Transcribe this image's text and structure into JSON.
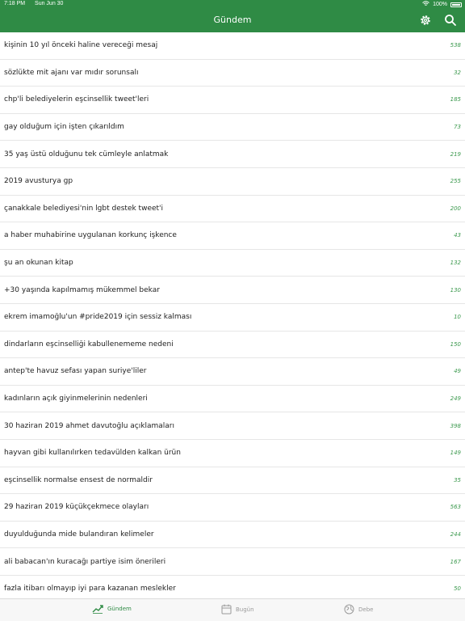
{
  "status_bar": {
    "time": "7:18 PM",
    "date": "Sun Jun 30",
    "battery": "100%"
  },
  "nav": {
    "title": "Gündem",
    "settings_icon": "gear-icon",
    "search_icon": "search-icon"
  },
  "topics": [
    {
      "title": "kişinin 10 yıl önceki haline vereceği mesaj",
      "count": "538"
    },
    {
      "title": "sözlükte mit ajanı var mıdır sorunsalı",
      "count": "32"
    },
    {
      "title": "chp'li belediyelerin eşcinsellik tweet'leri",
      "count": "185"
    },
    {
      "title": "gay olduğum için işten çıkarıldım",
      "count": "73"
    },
    {
      "title": "35 yaş üstü olduğunu tek cümleyle anlatmak",
      "count": "219"
    },
    {
      "title": "2019 avusturya gp",
      "count": "255"
    },
    {
      "title": "çanakkale belediyesi'nin lgbt destek tweet'i",
      "count": "200"
    },
    {
      "title": "a haber muhabirine uygulanan korkunç işkence",
      "count": "43"
    },
    {
      "title": "şu an okunan kitap",
      "count": "132"
    },
    {
      "title": "+30 yaşında kapılmamış mükemmel bekar",
      "count": "130"
    },
    {
      "title": "ekrem imamoğlu'un #pride2019 için sessiz kalması",
      "count": "10"
    },
    {
      "title": "dindarların eşcinselliği kabullenememe nedeni",
      "count": "150"
    },
    {
      "title": "antep'te havuz sefası yapan suriye'liler",
      "count": "49"
    },
    {
      "title": "kadınların açık giyinmelerinin nedenleri",
      "count": "249"
    },
    {
      "title": "30 haziran 2019 ahmet davutoğlu açıklamaları",
      "count": "398"
    },
    {
      "title": "hayvan gibi kullanılırken tedavülden kalkan ürün",
      "count": "149"
    },
    {
      "title": "eşcinsellik normalse ensest de normaldir",
      "count": "35"
    },
    {
      "title": "29 haziran 2019 küçükçekmece olayları",
      "count": "563"
    },
    {
      "title": "duyulduğunda mide bulandıran kelimeler",
      "count": "244"
    },
    {
      "title": "ali babacan'ın kuracağı partiye isim önerileri",
      "count": "167"
    },
    {
      "title": "fazla itibarı olmayıp iyi para kazanan meslekler",
      "count": "50"
    }
  ],
  "tabs": [
    {
      "label": "Gündem",
      "icon": "trending-icon",
      "active": true
    },
    {
      "label": "Bugün",
      "icon": "calendar-icon",
      "active": false
    },
    {
      "label": "Debe",
      "icon": "globe-icon",
      "active": false
    }
  ],
  "colors": {
    "accent": "#2f8b45",
    "count_text": "#3d9a4f"
  }
}
